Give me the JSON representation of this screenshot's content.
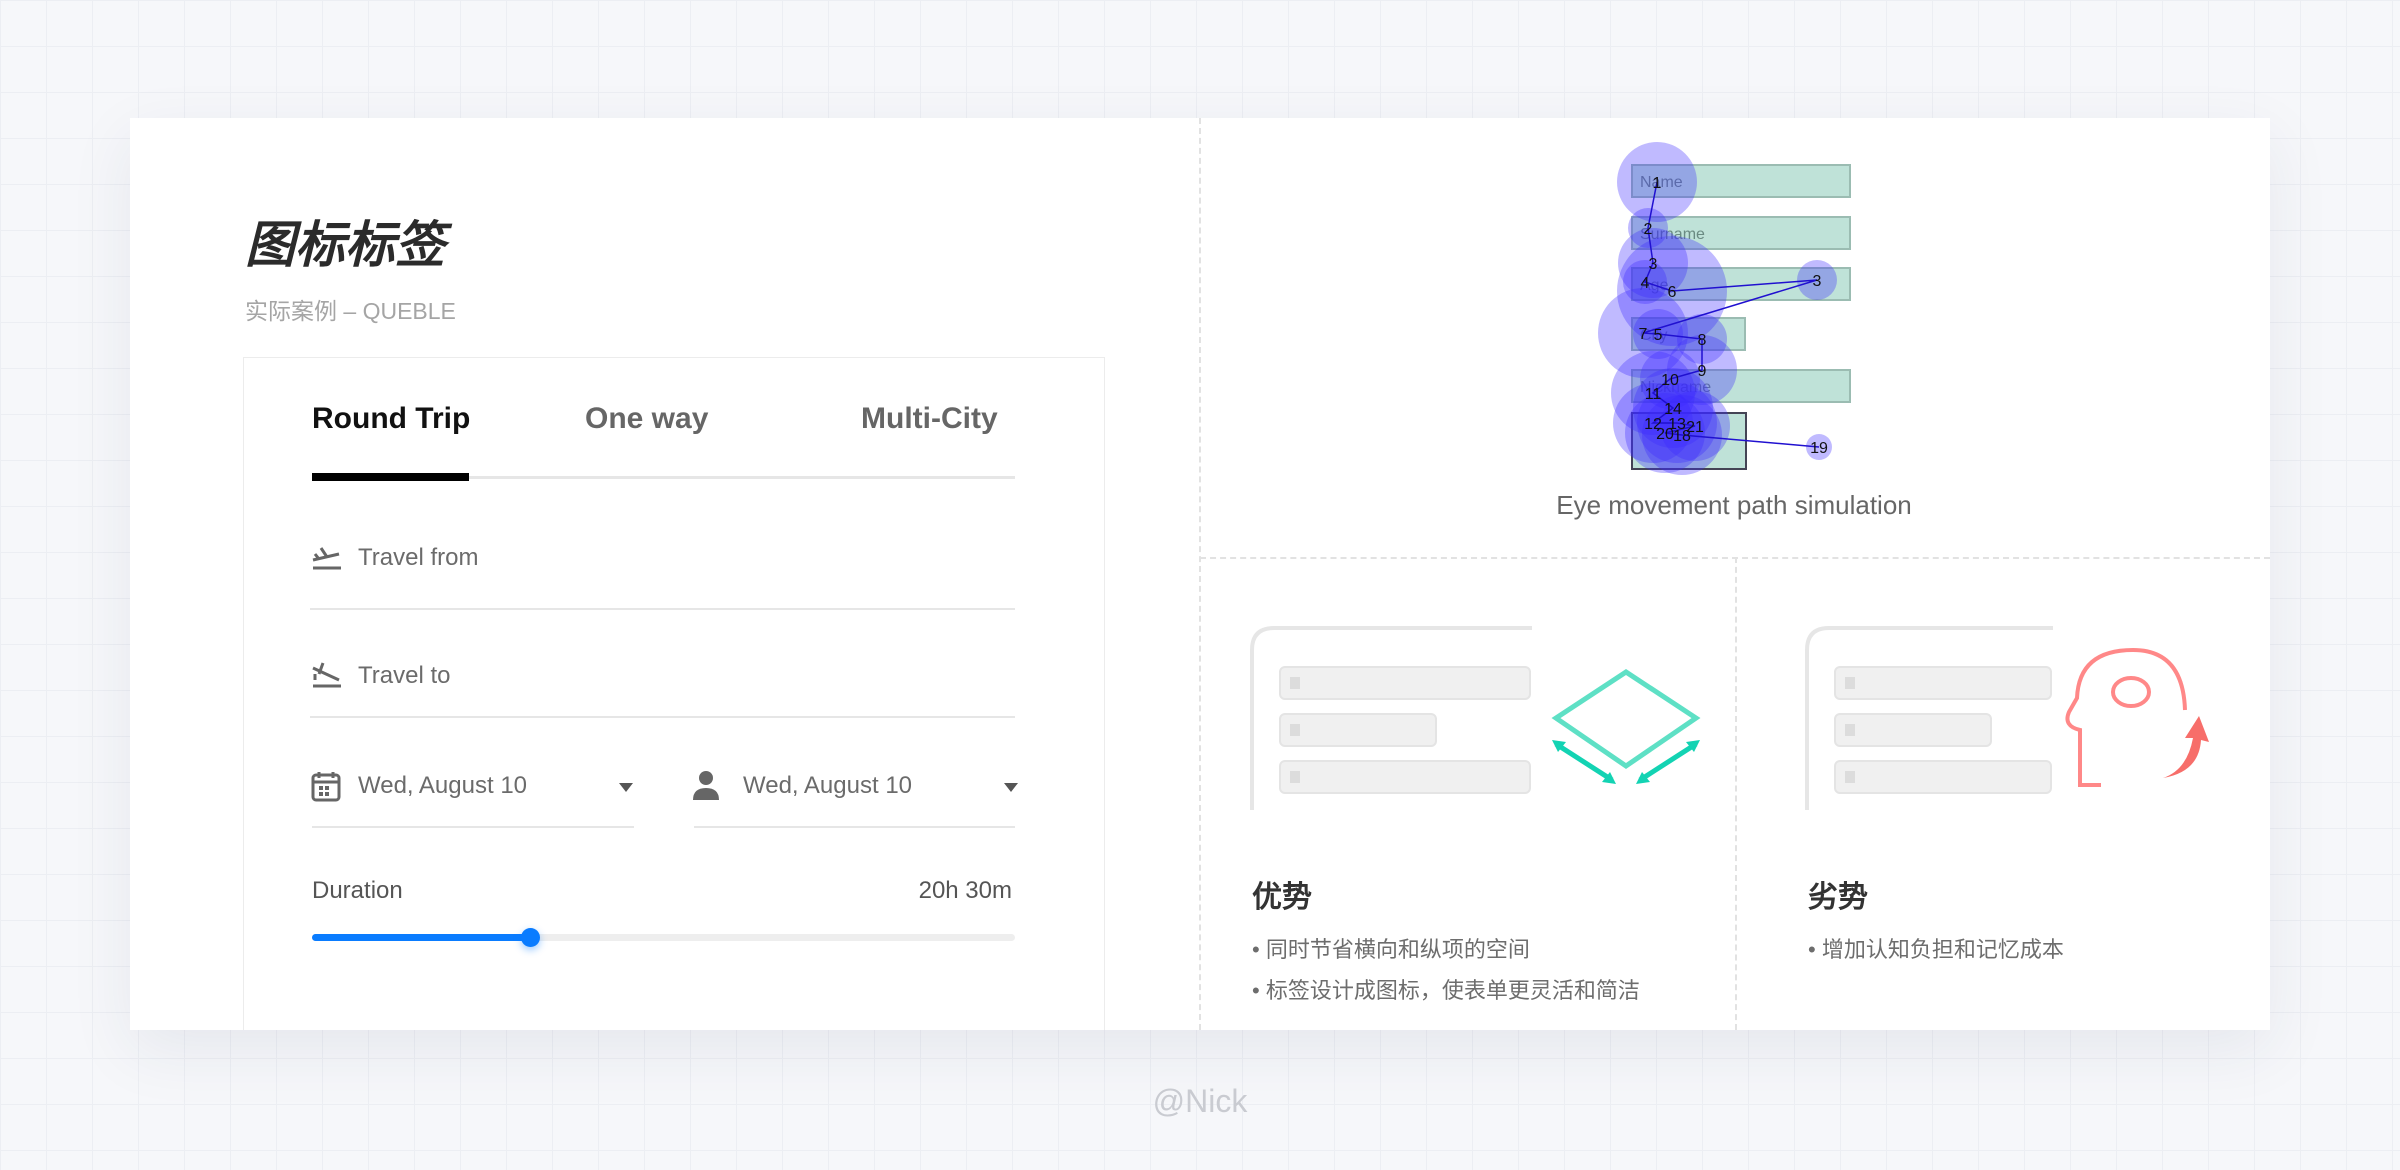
{
  "header": {
    "title": "图标标签",
    "subtitle": "实际案例 – QUEBLE"
  },
  "form": {
    "tabs": [
      {
        "label": "Round Trip",
        "active": true
      },
      {
        "label": "One way",
        "active": false
      },
      {
        "label": "Multi-City",
        "active": false
      }
    ],
    "travel_from": {
      "placeholder": "Travel from",
      "icon": "flight-takeoff-icon"
    },
    "travel_to": {
      "placeholder": "Travel to",
      "icon": "flight-land-icon"
    },
    "date_left": {
      "value": "Wed, August 10",
      "icon": "calendar-icon"
    },
    "date_right": {
      "value": "Wed, August 10",
      "icon": "person-icon"
    },
    "duration": {
      "label": "Duration",
      "value": "20h 30m",
      "slider_fraction": 0.31
    },
    "accent": "#0a7cff"
  },
  "heatmap": {
    "caption": "Eye movement path simulation",
    "fields": [
      "Name",
      "Surname",
      "Age",
      "City",
      "Nickname"
    ],
    "fixations": [
      "1",
      "2",
      "3",
      "4",
      "6",
      "3",
      "7",
      "5",
      "8",
      "9",
      "10",
      "11",
      "14",
      "12",
      "13",
      "21",
      "20",
      "18",
      "19"
    ]
  },
  "pros": {
    "title": "优势",
    "bullets": [
      "• 同时节省横向和纵项的空间",
      "• 标签设计成图标，使表单更灵活和简洁"
    ],
    "accent": "#3fd9b9"
  },
  "cons": {
    "title": "劣势",
    "bullets": [
      "• 增加认知负担和记忆成本"
    ],
    "accent": "#f77a78"
  },
  "credit": "@Nick"
}
